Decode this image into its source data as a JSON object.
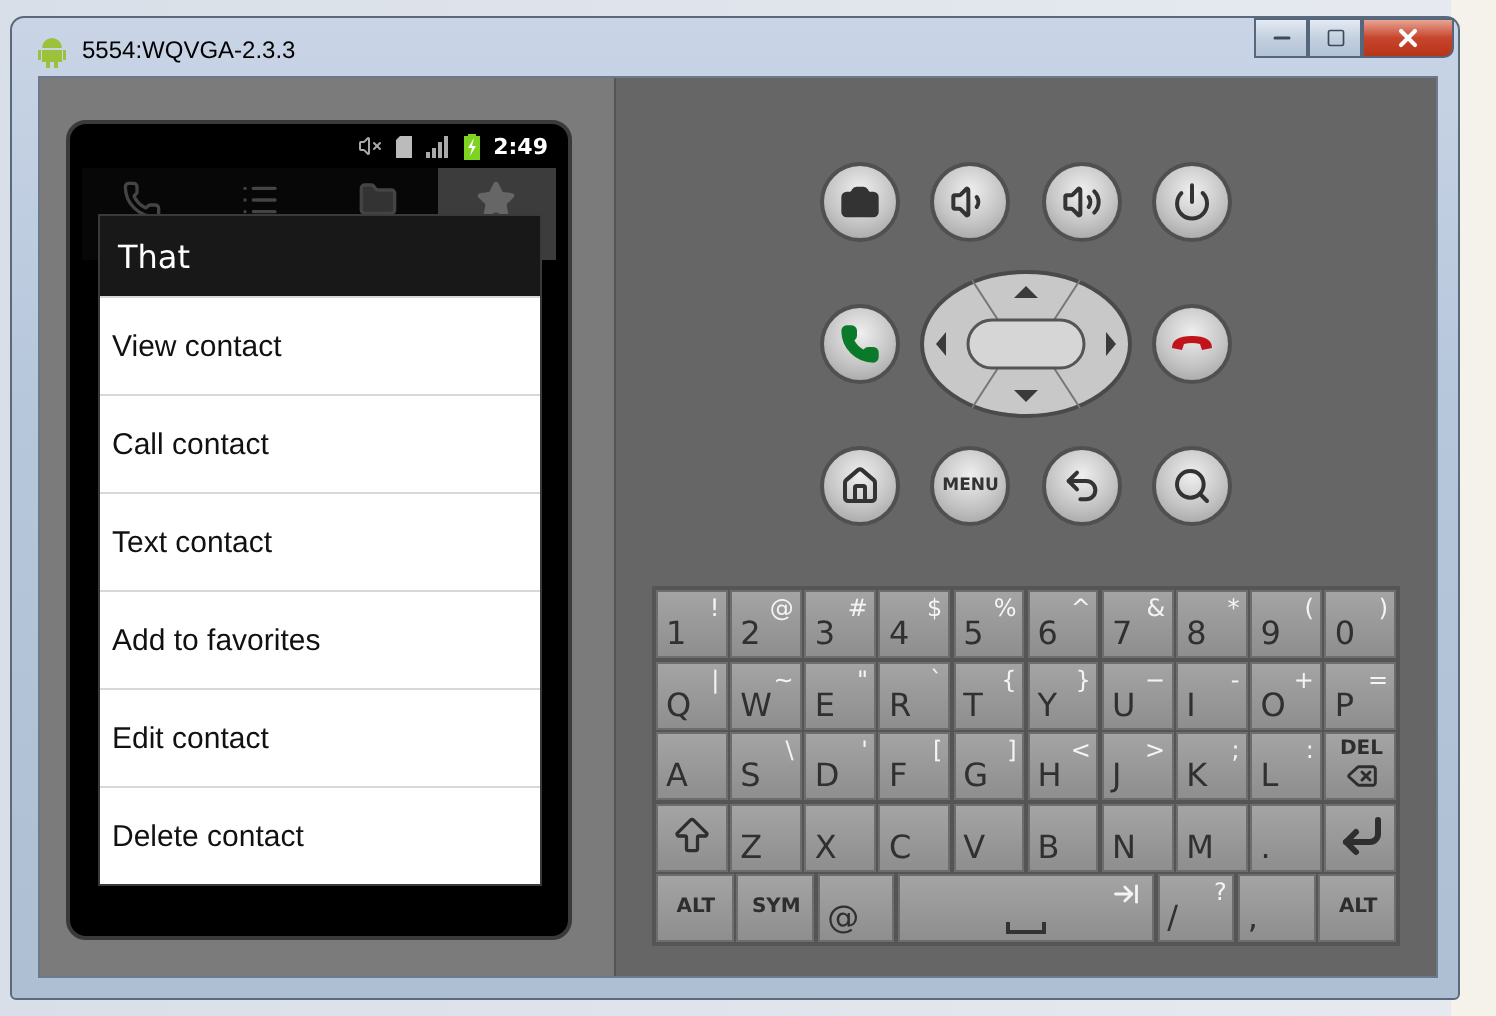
{
  "window": {
    "title": "5554:WQVGA-2.3.3"
  },
  "status_bar": {
    "time": "2:49"
  },
  "tabs": [
    {
      "kind": "phone",
      "selected": false
    },
    {
      "kind": "list",
      "selected": false
    },
    {
      "kind": "folder",
      "selected": false
    },
    {
      "kind": "star",
      "selected": true
    }
  ],
  "dialog": {
    "title": "That",
    "items": [
      "View contact",
      "Call contact",
      "Text contact",
      "Add to favorites",
      "Edit contact",
      "Delete contact"
    ]
  },
  "hardware_buttons": [
    {
      "kind": "camera"
    },
    {
      "kind": "volume-down"
    },
    {
      "kind": "volume-up"
    },
    {
      "kind": "power"
    },
    {
      "kind": "call"
    },
    {
      "kind": "dpad"
    },
    {
      "kind": "end-call"
    },
    {
      "kind": "home"
    },
    {
      "kind": "menu",
      "label": "MENU"
    },
    {
      "kind": "back"
    },
    {
      "kind": "search"
    }
  ],
  "keyboard": {
    "rows": [
      {
        "keys": [
          {
            "kind": "char",
            "main": "1",
            "secondary": "!"
          },
          {
            "kind": "char",
            "main": "2",
            "secondary": "@"
          },
          {
            "kind": "char",
            "main": "3",
            "secondary": "#"
          },
          {
            "kind": "char",
            "main": "4",
            "secondary": "$"
          },
          {
            "kind": "char",
            "main": "5",
            "secondary": "%"
          },
          {
            "kind": "char",
            "main": "6",
            "secondary": "^"
          },
          {
            "kind": "char",
            "main": "7",
            "secondary": "&"
          },
          {
            "kind": "char",
            "main": "8",
            "secondary": "*"
          },
          {
            "kind": "char",
            "main": "9",
            "secondary": "("
          },
          {
            "kind": "char",
            "main": "0",
            "secondary": ")"
          }
        ]
      },
      {
        "keys": [
          {
            "kind": "char",
            "main": "Q",
            "secondary": "|"
          },
          {
            "kind": "char",
            "main": "W",
            "secondary": "~"
          },
          {
            "kind": "char",
            "main": "E",
            "secondary": "\""
          },
          {
            "kind": "char",
            "main": "R",
            "secondary": "`"
          },
          {
            "kind": "char",
            "main": "T",
            "secondary": "{"
          },
          {
            "kind": "char",
            "main": "Y",
            "secondary": "}"
          },
          {
            "kind": "char",
            "main": "U",
            "secondary": "−"
          },
          {
            "kind": "char",
            "main": "I",
            "secondary": "-"
          },
          {
            "kind": "char",
            "main": "O",
            "secondary": "+"
          },
          {
            "kind": "char",
            "main": "P",
            "secondary": "="
          }
        ]
      },
      {
        "keys": [
          {
            "kind": "char",
            "main": "A"
          },
          {
            "kind": "char",
            "main": "S",
            "secondary": "\\"
          },
          {
            "kind": "char",
            "main": "D",
            "secondary": "'"
          },
          {
            "kind": "char",
            "main": "F",
            "secondary": "["
          },
          {
            "kind": "char",
            "main": "G",
            "secondary": "]"
          },
          {
            "kind": "char",
            "main": "H",
            "secondary": "<"
          },
          {
            "kind": "char",
            "main": "J",
            "secondary": ">"
          },
          {
            "kind": "char",
            "main": "K",
            "secondary": ";"
          },
          {
            "kind": "char",
            "main": "L",
            "secondary": ":"
          },
          {
            "kind": "del",
            "main": "DEL"
          }
        ]
      },
      {
        "keys": [
          {
            "kind": "shift"
          },
          {
            "kind": "char",
            "main": "Z"
          },
          {
            "kind": "char",
            "main": "X"
          },
          {
            "kind": "char",
            "main": "C"
          },
          {
            "kind": "char",
            "main": "V"
          },
          {
            "kind": "char",
            "main": "B"
          },
          {
            "kind": "char",
            "main": "N"
          },
          {
            "kind": "char",
            "main": "M"
          },
          {
            "kind": "char",
            "main": "."
          },
          {
            "kind": "enter"
          }
        ]
      },
      {
        "keys": [
          {
            "kind": "label",
            "main": "ALT"
          },
          {
            "kind": "label",
            "main": "SYM"
          },
          {
            "kind": "char",
            "main": "@"
          },
          {
            "kind": "space"
          },
          {
            "kind": "char",
            "main": "/",
            "secondary": "?"
          },
          {
            "kind": "char",
            "main": ","
          },
          {
            "kind": "label",
            "main": "ALT"
          }
        ]
      }
    ]
  }
}
